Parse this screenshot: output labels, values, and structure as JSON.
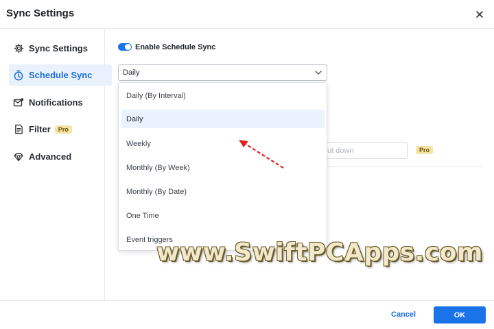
{
  "window": {
    "title": "Sync Settings"
  },
  "sidebar": {
    "items": [
      {
        "label": "Sync Settings",
        "icon": "gear-icon",
        "active": false
      },
      {
        "label": "Schedule Sync",
        "icon": "clock-icon",
        "active": true
      },
      {
        "label": "Notifications",
        "icon": "mail-icon",
        "active": false
      },
      {
        "label": "Filter",
        "icon": "filter-icon",
        "active": false,
        "badge": "Pro"
      },
      {
        "label": "Advanced",
        "icon": "diamond-icon",
        "active": false
      }
    ]
  },
  "schedule": {
    "toggle_label": "Enable Schedule Sync",
    "toggle_on": true,
    "selected": "Daily",
    "options": [
      "Daily (By Interval)",
      "Daily",
      "Weekly",
      "Monthly (By Week)",
      "Monthly (By Date)",
      "One Time",
      "Event triggers"
    ]
  },
  "background": {
    "input_placeholder": "ut down",
    "pro_badge": "Pro"
  },
  "watermark": "www.SwiftPCApps.com",
  "footer": {
    "cancel_label": "Cancel",
    "ok_label": "OK"
  },
  "colors": {
    "accent": "#1a73e8",
    "pro_badge": "#f5e3a6",
    "arrow": "#e02020"
  }
}
